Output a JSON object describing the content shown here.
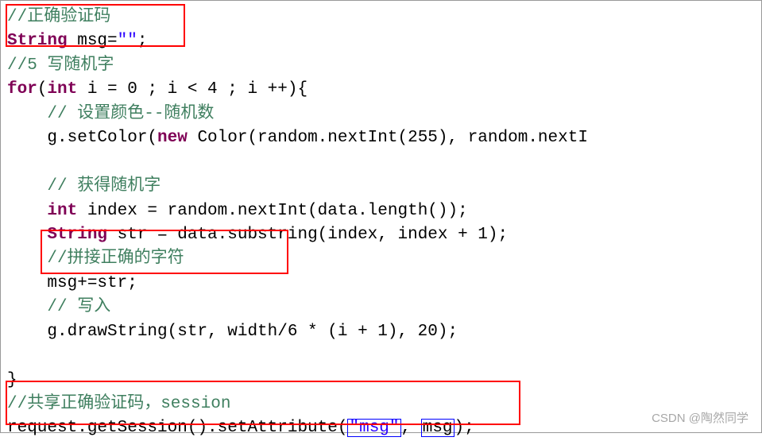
{
  "lines": {
    "l1_comment": "//正确验证码",
    "l2_type": "String",
    "l2_var": " msg=",
    "l2_str": "\"\"",
    "l2_end": ";",
    "l3_comment": "//5 写随机字",
    "l4_for": "for",
    "l4_p1": "(",
    "l4_int": "int",
    "l4_p2": " i = 0 ; i < 4 ; i ++){",
    "l5_comment": "    // 设置颜色--随机数",
    "l6_p1": "    g.setColor(",
    "l6_new": "new",
    "l6_p2": " Color(random.nextInt(255), random.nextI",
    "l7_blank": "",
    "l8_comment": "    // 获得随机字",
    "l9_int": "    int",
    "l9_rest": " index = random.nextInt(data.length());",
    "l10_type": "    String",
    "l10_rest": " str = data.substring(index, index + 1);",
    "l11_comment": "    //拼接正确的字符",
    "l12": "    msg+=str;",
    "l13_comment": "    // 写入",
    "l14": "    g.drawString(str, width/6 * (i + 1), 20);",
    "l15_blank": "",
    "l16": "}",
    "l17_comment": "//共享正确验证码，session",
    "l18_p1": "request.getSession().setAttribute(",
    "l18_str": "\"msg\"",
    "l18_p2": ", ",
    "l18_var": "msg",
    "l18_p3": ");"
  },
  "watermark": "CSDN @陶然同学"
}
